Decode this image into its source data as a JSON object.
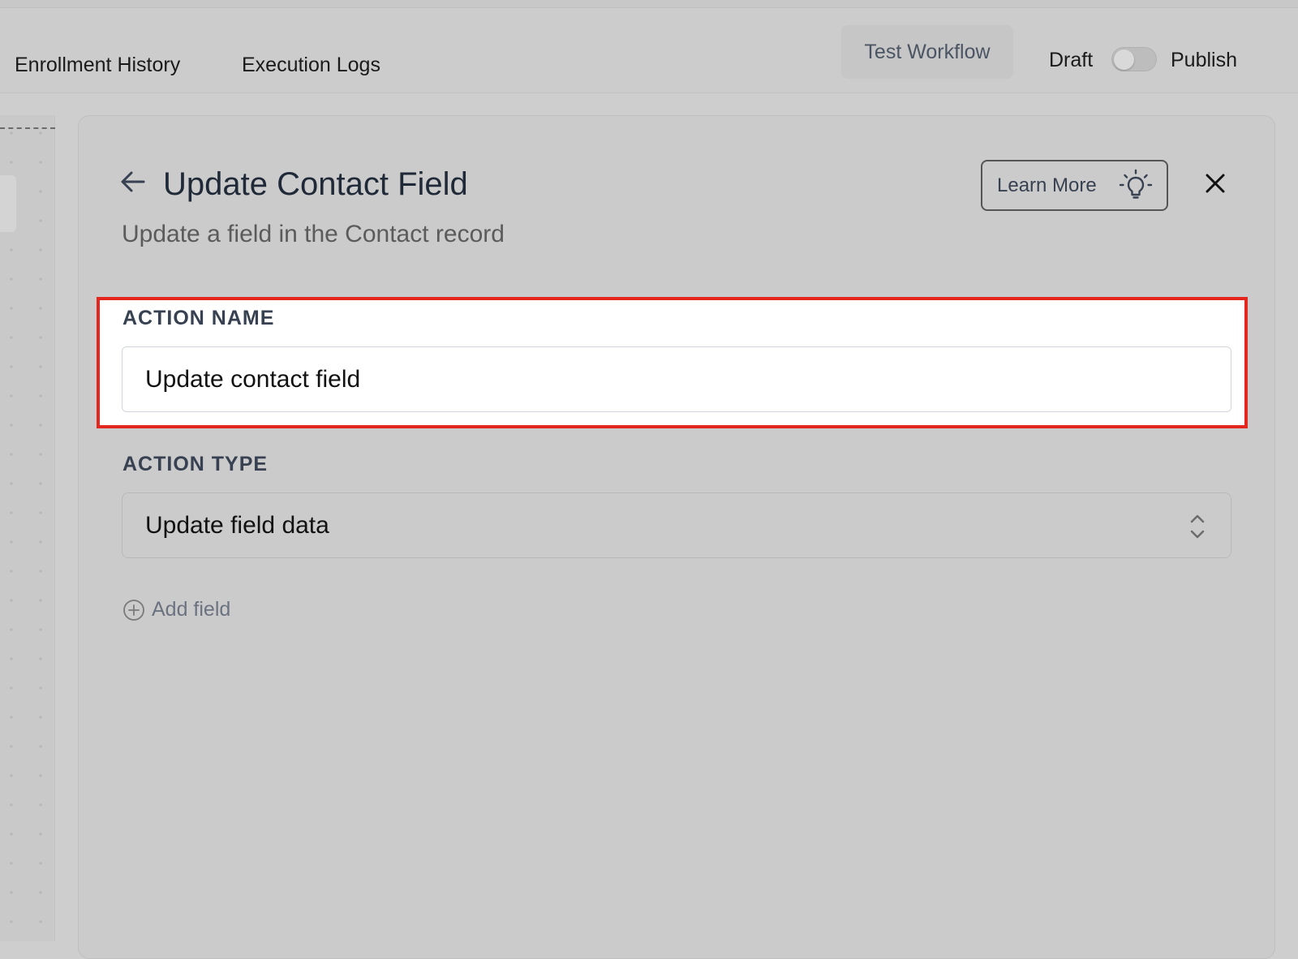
{
  "topbar": {
    "tabs": [
      "Enrollment History",
      "Execution Logs"
    ],
    "test_button": "Test Workflow",
    "draft_label": "Draft",
    "publish_label": "Publish",
    "publish_toggle_on": false
  },
  "panel": {
    "title": "Update Contact Field",
    "subtitle": "Update a field in the Contact record",
    "learn_more": "Learn More",
    "action_name": {
      "label": "ACTION NAME",
      "value": "Update contact field"
    },
    "action_type": {
      "label": "ACTION TYPE",
      "value": "Update field data"
    },
    "add_field": "Add field"
  },
  "icons": {
    "back": "arrow-left-icon",
    "learn": "lightbulb-icon",
    "close": "close-icon",
    "select": "chevron-up-down-icon",
    "add": "plus-circle-icon"
  },
  "colors": {
    "highlight_border": "#e3271e"
  }
}
